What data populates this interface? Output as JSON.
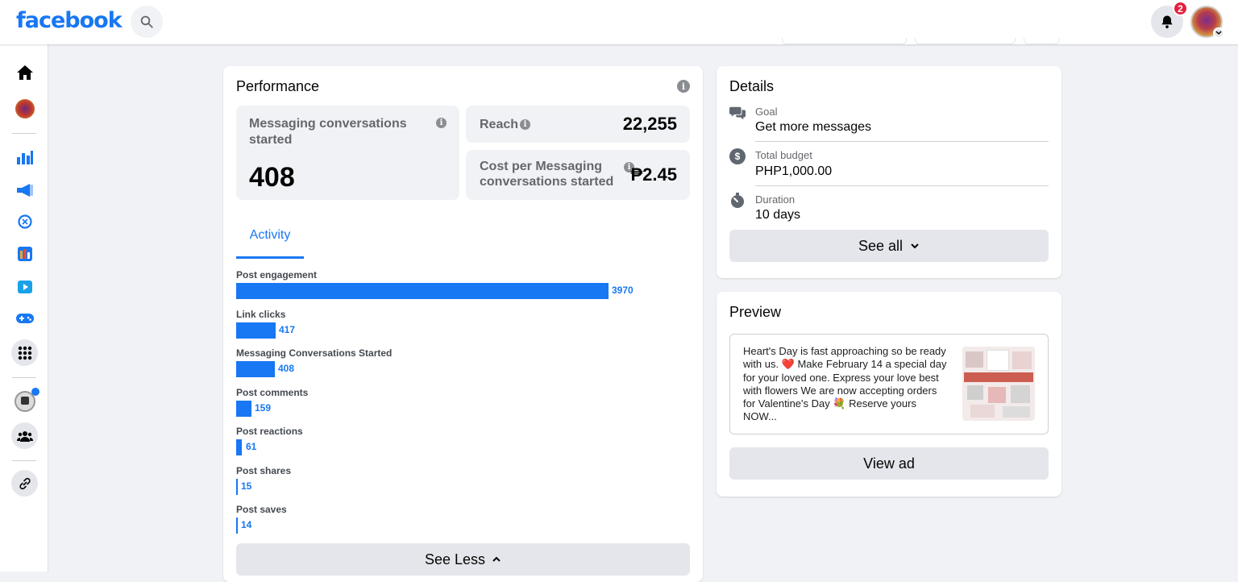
{
  "topbar": {
    "logo": "facebook",
    "notification_count": "2"
  },
  "performance": {
    "title": "Performance",
    "messaging_label": "Messaging conversations started",
    "messaging_value": "408",
    "reach_label": "Reach",
    "reach_value": "22,255",
    "cost_label": "Cost per Messaging conversations started",
    "cost_value": "₱2.45",
    "tab_activity": "Activity",
    "bars": [
      {
        "label": "Post engagement",
        "value": "3970"
      },
      {
        "label": "Link clicks",
        "value": "417"
      },
      {
        "label": "Messaging Conversations Started",
        "value": "408"
      },
      {
        "label": "Post comments",
        "value": "159"
      },
      {
        "label": "Post reactions",
        "value": "61"
      },
      {
        "label": "Post shares",
        "value": "15"
      },
      {
        "label": "Post saves",
        "value": "14"
      }
    ],
    "see_less": "See Less"
  },
  "details": {
    "title": "Details",
    "goal_label": "Goal",
    "goal_value": "Get more messages",
    "budget_label": "Total budget",
    "budget_value": "PHP1,000.00",
    "duration_label": "Duration",
    "duration_value": "10 days",
    "see_all": "See all"
  },
  "preview": {
    "title": "Preview",
    "text": "Heart's Day is fast approaching so be ready with us. ❤️ Make February 14 a special day for your loved one. Express your love best with flowers We are now accepting orders for Valentine's Day 💐 Reserve yours NOW...",
    "view_ad": "View ad"
  },
  "colors": {
    "brand": "#1877f2",
    "badge": "#e41e3f"
  }
}
